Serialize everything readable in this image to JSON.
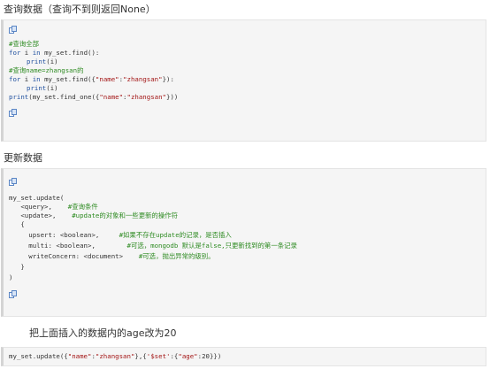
{
  "section1": {
    "heading": "查询数据（查询不到则返回None）",
    "code": {
      "comment_all": "#查询全部",
      "for1_kw": "for",
      "for1_var": " i ",
      "for1_in": "in",
      "for1_expr": " my_set.find():",
      "print1_fn": "print",
      "print1_arg": "(i)",
      "comment_name": "#查询name=zhangsan的",
      "for2_kw": "for",
      "for2_var": " i ",
      "for2_in": "in",
      "for2_pre": " my_set.find({",
      "for2_key": "\"name\"",
      "for2_colon": ":",
      "for2_val": "\"zhangsan\"",
      "for2_post": "}):",
      "print2_fn": "print",
      "print2_arg": "(i)",
      "print3_fn": "print",
      "print3_pre": "(my_set.find_one({",
      "print3_key": "\"name\"",
      "print3_colon": ":",
      "print3_val": "\"zhangsan\"",
      "print3_post": "}))"
    }
  },
  "section2": {
    "heading": "更新数据",
    "code": {
      "line1": "my_set.update(",
      "query": "   <query>,    ",
      "query_comment": "#查询条件",
      "update": "   <update>,    ",
      "update_comment": "#update的对象和一些更新的操作符",
      "brace_open": "   {",
      "upsert": "     upsert: <boolean>,     ",
      "upsert_comment": "#如果不存在update的记录，是否插入",
      "multi": "     multi: <boolean>,        ",
      "multi_comment": "#可选，mongodb 默认是false,只更新找到的第一条记录",
      "write": "     writeConcern: <document>    ",
      "write_comment": "#可选，抛出异常的级别。",
      "brace_close": "   }",
      "paren_close": ")"
    }
  },
  "section3": {
    "heading": "把上面插入的数据内的age改为20",
    "code": {
      "pre": "my_set.update({",
      "k1": "\"name\"",
      "c1": ":",
      "v1": "\"zhangsan\"",
      "mid": "},{",
      "k2": "'$set'",
      "c2": ":{",
      "k3": "\"age\"",
      "c3": ":20}})"
    }
  },
  "icons": {
    "copy": "copy-code-icon"
  },
  "colors": {
    "keyword": "#1f4f9e",
    "string": "#a31515",
    "comment": "#2e8b22",
    "code_bg": "#f5f5f5"
  }
}
